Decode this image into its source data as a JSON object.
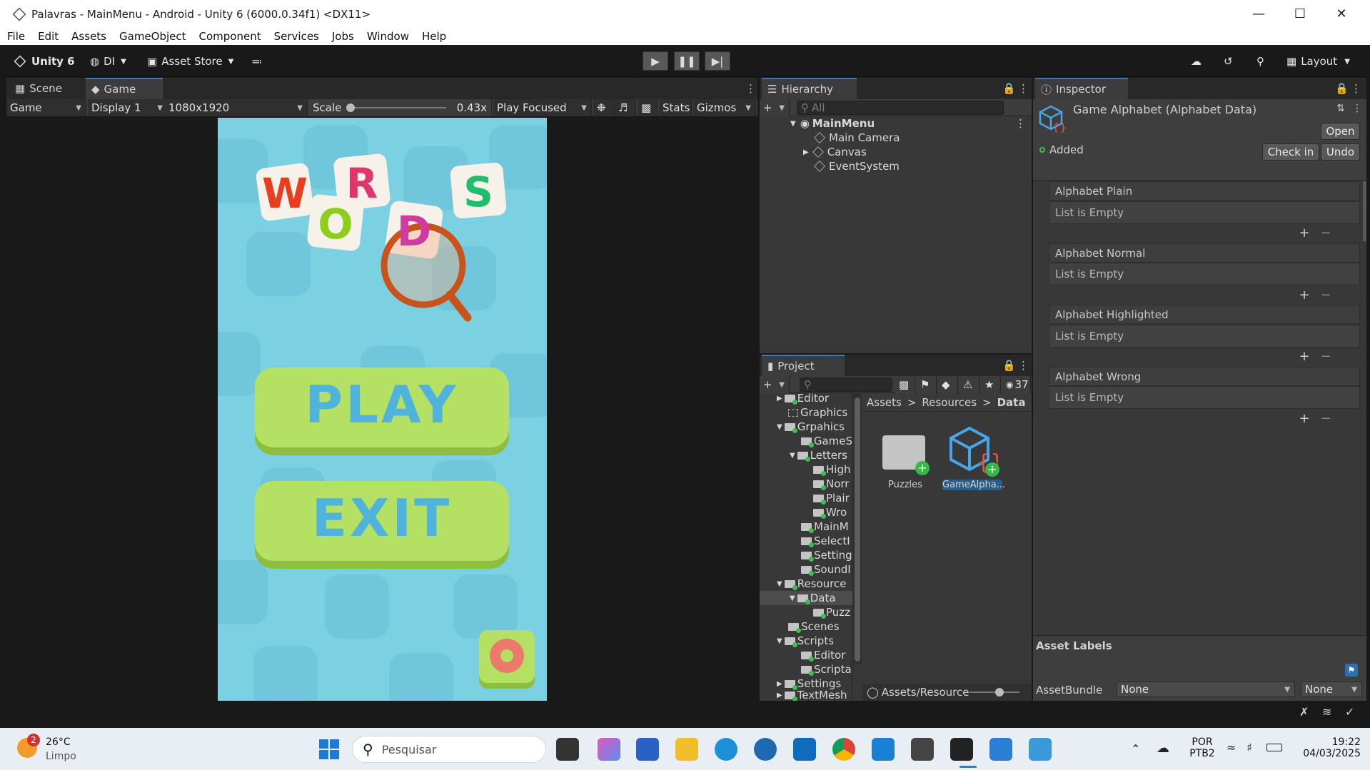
{
  "window": {
    "title": "Palavras - MainMenu - Android - Unity 6 (6000.0.34f1) <DX11>"
  },
  "menu": [
    "File",
    "Edit",
    "Assets",
    "GameObject",
    "Component",
    "Services",
    "Jobs",
    "Window",
    "Help"
  ],
  "toolbar": {
    "brand": "Unity 6",
    "account": "DI",
    "asset_store": "Asset Store",
    "layout": "Layout"
  },
  "scene_tabs": {
    "scene": "Scene",
    "game": "Game"
  },
  "game_toolbar": {
    "mode": "Game",
    "display": "Display 1",
    "resolution": "1080x1920",
    "scale_label": "Scale",
    "scale_value": "0.43x",
    "play_mode": "Play Focused",
    "stats": "Stats",
    "gizmos": "Gizmos"
  },
  "game": {
    "logo_letters": [
      "W",
      "O",
      "R",
      "D",
      "S"
    ],
    "play": "PLAY",
    "exit": "EXIT"
  },
  "hierarchy": {
    "title": "Hierarchy",
    "search_placeholder": "All",
    "scene": "MainMenu",
    "items": [
      "Main Camera",
      "Canvas",
      "EventSystem"
    ]
  },
  "project": {
    "title": "Project",
    "count": "37",
    "tree": [
      "Editor",
      "Graphics",
      "Grpahics",
      "GameS",
      "Letters",
      "High",
      "Norr",
      "Plair",
      "Wro",
      "MainM",
      "SelectI",
      "Setting",
      "SoundI",
      "Resource",
      "Data",
      "Puzz",
      "Scenes",
      "Scripts",
      "Editor",
      "Scripta",
      "Settings",
      "TextMesh"
    ],
    "breadcrumb": [
      "Assets",
      "Resources",
      "Data"
    ],
    "assets": [
      {
        "label": "Puzzles"
      },
      {
        "label": "GameAlpha..."
      }
    ],
    "path": "Assets/Resource"
  },
  "inspector": {
    "title": "Inspector",
    "asset_title": "Game Alphabet (Alphabet Data)",
    "open": "Open",
    "status": "Added",
    "check_in": "Check in",
    "undo": "Undo",
    "lists": [
      {
        "name": "Alphabet Plain",
        "body": "List is Empty"
      },
      {
        "name": "Alphabet Normal",
        "body": "List is Empty"
      },
      {
        "name": "Alphabet Highlighted",
        "body": "List is Empty"
      },
      {
        "name": "Alphabet Wrong",
        "body": "List is Empty"
      }
    ],
    "asset_labels": "Asset Labels",
    "asset_bundle": "AssetBundle",
    "bundle_value": "None",
    "variant_value": "None"
  },
  "taskbar": {
    "temp": "26°C",
    "weather": "Limpo",
    "weather_badge": "2",
    "search": "Pesquisar",
    "lang1": "POR",
    "lang2": "PTB2",
    "time": "19:22",
    "date": "04/03/2025"
  }
}
